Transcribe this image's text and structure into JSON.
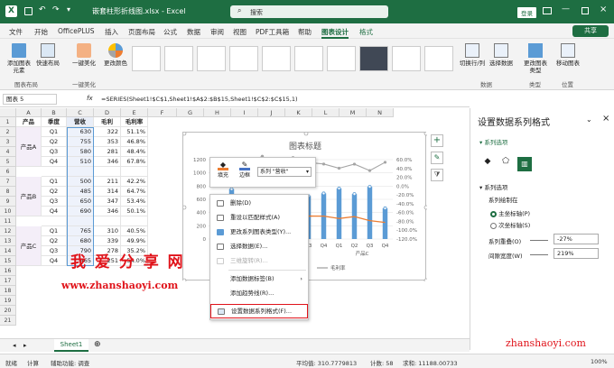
{
  "app": {
    "qa_save_icon": "save-icon",
    "title": "嵌套柱形折线图.xlsx - Excel",
    "search_placeholder": "搜索",
    "login_label": "登录"
  },
  "menu": [
    "文件",
    "开始",
    "OfficePLUS",
    "插入",
    "页面布局",
    "公式",
    "数据",
    "审阅",
    "视图",
    "PDF工具箱",
    "帮助",
    "图表设计",
    "格式"
  ],
  "share_label": "共享",
  "ribbon": {
    "buttons": [
      {
        "label": "添加图表元素"
      },
      {
        "label": "快速布局"
      },
      {
        "label": "更改颜色"
      },
      {
        "label": "切换行/列"
      },
      {
        "label": "选择数据"
      },
      {
        "label": "更改图表类型"
      },
      {
        "label": "移动图表"
      }
    ],
    "one_click": "一键美化",
    "groups": [
      "图表布局",
      "一键美化",
      "数据",
      "类型",
      "位置"
    ],
    "styles_count_hint": "图表样式"
  },
  "formula_bar": {
    "name_box": "图表 5",
    "fx": "fx",
    "formula": "=SERIES(Sheet1!$C$1,Sheet1!$A$2:$B$15,Sheet1!$C$2:$C$15,1)"
  },
  "columns": [
    "A",
    "B",
    "C",
    "D",
    "E",
    "F",
    "G",
    "H",
    "I",
    "J",
    "K",
    "L",
    "M",
    "N"
  ],
  "table": {
    "headers": [
      "产品",
      "季度",
      "营收",
      "毛利",
      "毛利率"
    ],
    "groups": [
      "产品A",
      "产品B",
      "产品C"
    ],
    "rows": [
      [
        "Q1",
        "630",
        "322",
        "51.1%"
      ],
      [
        "Q2",
        "755",
        "353",
        "46.8%"
      ],
      [
        "Q3",
        "580",
        "281",
        "48.4%"
      ],
      [
        "Q4",
        "510",
        "346",
        "67.8%"
      ],
      [
        "",
        "",
        "",
        ""
      ],
      [
        "Q1",
        "500",
        "211",
        "42.2%"
      ],
      [
        "Q2",
        "485",
        "314",
        "64.7%"
      ],
      [
        "Q3",
        "650",
        "347",
        "53.4%"
      ],
      [
        "Q4",
        "690",
        "346",
        "50.1%"
      ],
      [
        "",
        "",
        "",
        ""
      ],
      [
        "Q1",
        "765",
        "310",
        "40.5%"
      ],
      [
        "Q2",
        "680",
        "339",
        "49.9%"
      ],
      [
        "Q3",
        "790",
        "278",
        "35.2%"
      ],
      [
        "Q4",
        "465",
        "251",
        "54.0%"
      ]
    ]
  },
  "row_numbers": [
    "1",
    "2",
    "3",
    "4",
    "5",
    "6",
    "7",
    "8",
    "9",
    "10",
    "11",
    "12",
    "13",
    "14",
    "15",
    "16",
    "17",
    "18",
    "19",
    "20",
    "21"
  ],
  "chart_data": {
    "type": "bar",
    "title": "图表标题",
    "categories": [
      "Q1",
      "Q2",
      "Q3",
      "Q4",
      "Q1",
      "Q2",
      "Q3",
      "Q4",
      "Q1",
      "Q2",
      "Q3",
      "Q4"
    ],
    "group_labels": [
      "产品B",
      "产品C"
    ],
    "y_left_ticks": [
      "1200",
      "1000",
      "800",
      "600",
      "400",
      "200",
      "0"
    ],
    "y_right_ticks": [
      "60.0%",
      "40.0%",
      "20.0%",
      "0.0%",
      "-20.0%",
      "-40.0%",
      "-60.0%",
      "-80.0%",
      "-100.0%",
      "-120.0%"
    ],
    "series": [
      {
        "name": "营收",
        "values": [
          630,
          755,
          580,
          510,
          500,
          485,
          650,
          690,
          765,
          680,
          790,
          465
        ]
      },
      {
        "name": "毛利",
        "values": [
          322,
          353,
          281,
          346,
          211,
          314,
          347,
          346,
          310,
          339,
          278,
          251
        ]
      },
      {
        "name": "毛利率",
        "values": [
          51.1,
          46.8,
          48.4,
          67.8,
          42.2,
          64.7,
          53.4,
          50.1,
          40.5,
          49.9,
          35.2,
          54.0
        ]
      }
    ],
    "legend_visible": [
      "毛利",
      "毛利率"
    ]
  },
  "mini_toolbar": {
    "fill_label": "填充",
    "outline_label": "边框",
    "series_select": "系列 \"营收\""
  },
  "context_menu": {
    "items": [
      {
        "label": "删除(D)",
        "icon": "delete-icon"
      },
      {
        "label": "重设以匹配样式(A)",
        "icon": "reset-icon"
      },
      {
        "label": "更改系列图表类型(Y)...",
        "icon": "chart-type-icon"
      },
      {
        "label": "选择数据(E)...",
        "icon": "select-data-icon"
      },
      {
        "label": "三维旋转(R)...",
        "icon": "rotate-3d-icon"
      },
      {
        "label": "添加数据标签(B)",
        "icon": ""
      },
      {
        "label": "添加趋势线(R)...",
        "icon": ""
      },
      {
        "label": "设置数据系列格式(F)...",
        "icon": "format-series-icon"
      }
    ]
  },
  "pane": {
    "title": "设置数据系列格式",
    "section_tab": "系列选项",
    "section": "系列选项",
    "plot_on": "系列绘制在",
    "primary": "主坐标轴(P)",
    "secondary": "次坐标轴(S)",
    "overlap_label": "系列重叠(O)",
    "overlap_value": "-27%",
    "gap_label": "间隙宽度(W)",
    "gap_value": "219%"
  },
  "sheet_tab": "Sheet1",
  "status": {
    "ready": "就绪",
    "calc": "计算",
    "access": "辅助功能: 调查",
    "avg": "平均值: 310.7779813",
    "count": "计数: 58",
    "sum": "求和: 11188.00733",
    "zoom": "100%"
  },
  "watermark": {
    "cn": "我 爱 分 享 网",
    "url": "www.zhanshaoyi.com",
    "corner": "zhanshaoyi.com"
  },
  "colors": {
    "excel_green": "#1e6e42",
    "bar_blue": "#5b9bd5",
    "line_orange": "#ed7d31",
    "line_gray": "#a5a5a5",
    "highlight_red": "#e0131a"
  }
}
